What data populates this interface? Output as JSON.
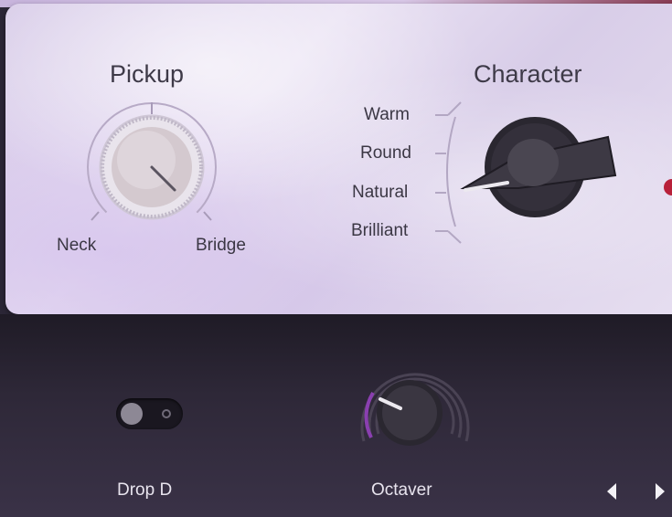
{
  "pickup": {
    "title": "Pickup",
    "left_label": "Neck",
    "right_label": "Bridge",
    "value": "Bridge"
  },
  "character": {
    "title": "Character",
    "options": [
      "Warm",
      "Round",
      "Natural",
      "Brilliant"
    ],
    "selected": "Natural"
  },
  "drop_d": {
    "label": "Drop D",
    "enabled": false
  },
  "octaver": {
    "label": "Octaver"
  },
  "nav": {
    "prev_icon": "chevron-left-icon",
    "next_icon": "chevron-right-icon"
  },
  "colors": {
    "accent": "#b8203a",
    "octaver_arc": "#8a3fb0"
  }
}
